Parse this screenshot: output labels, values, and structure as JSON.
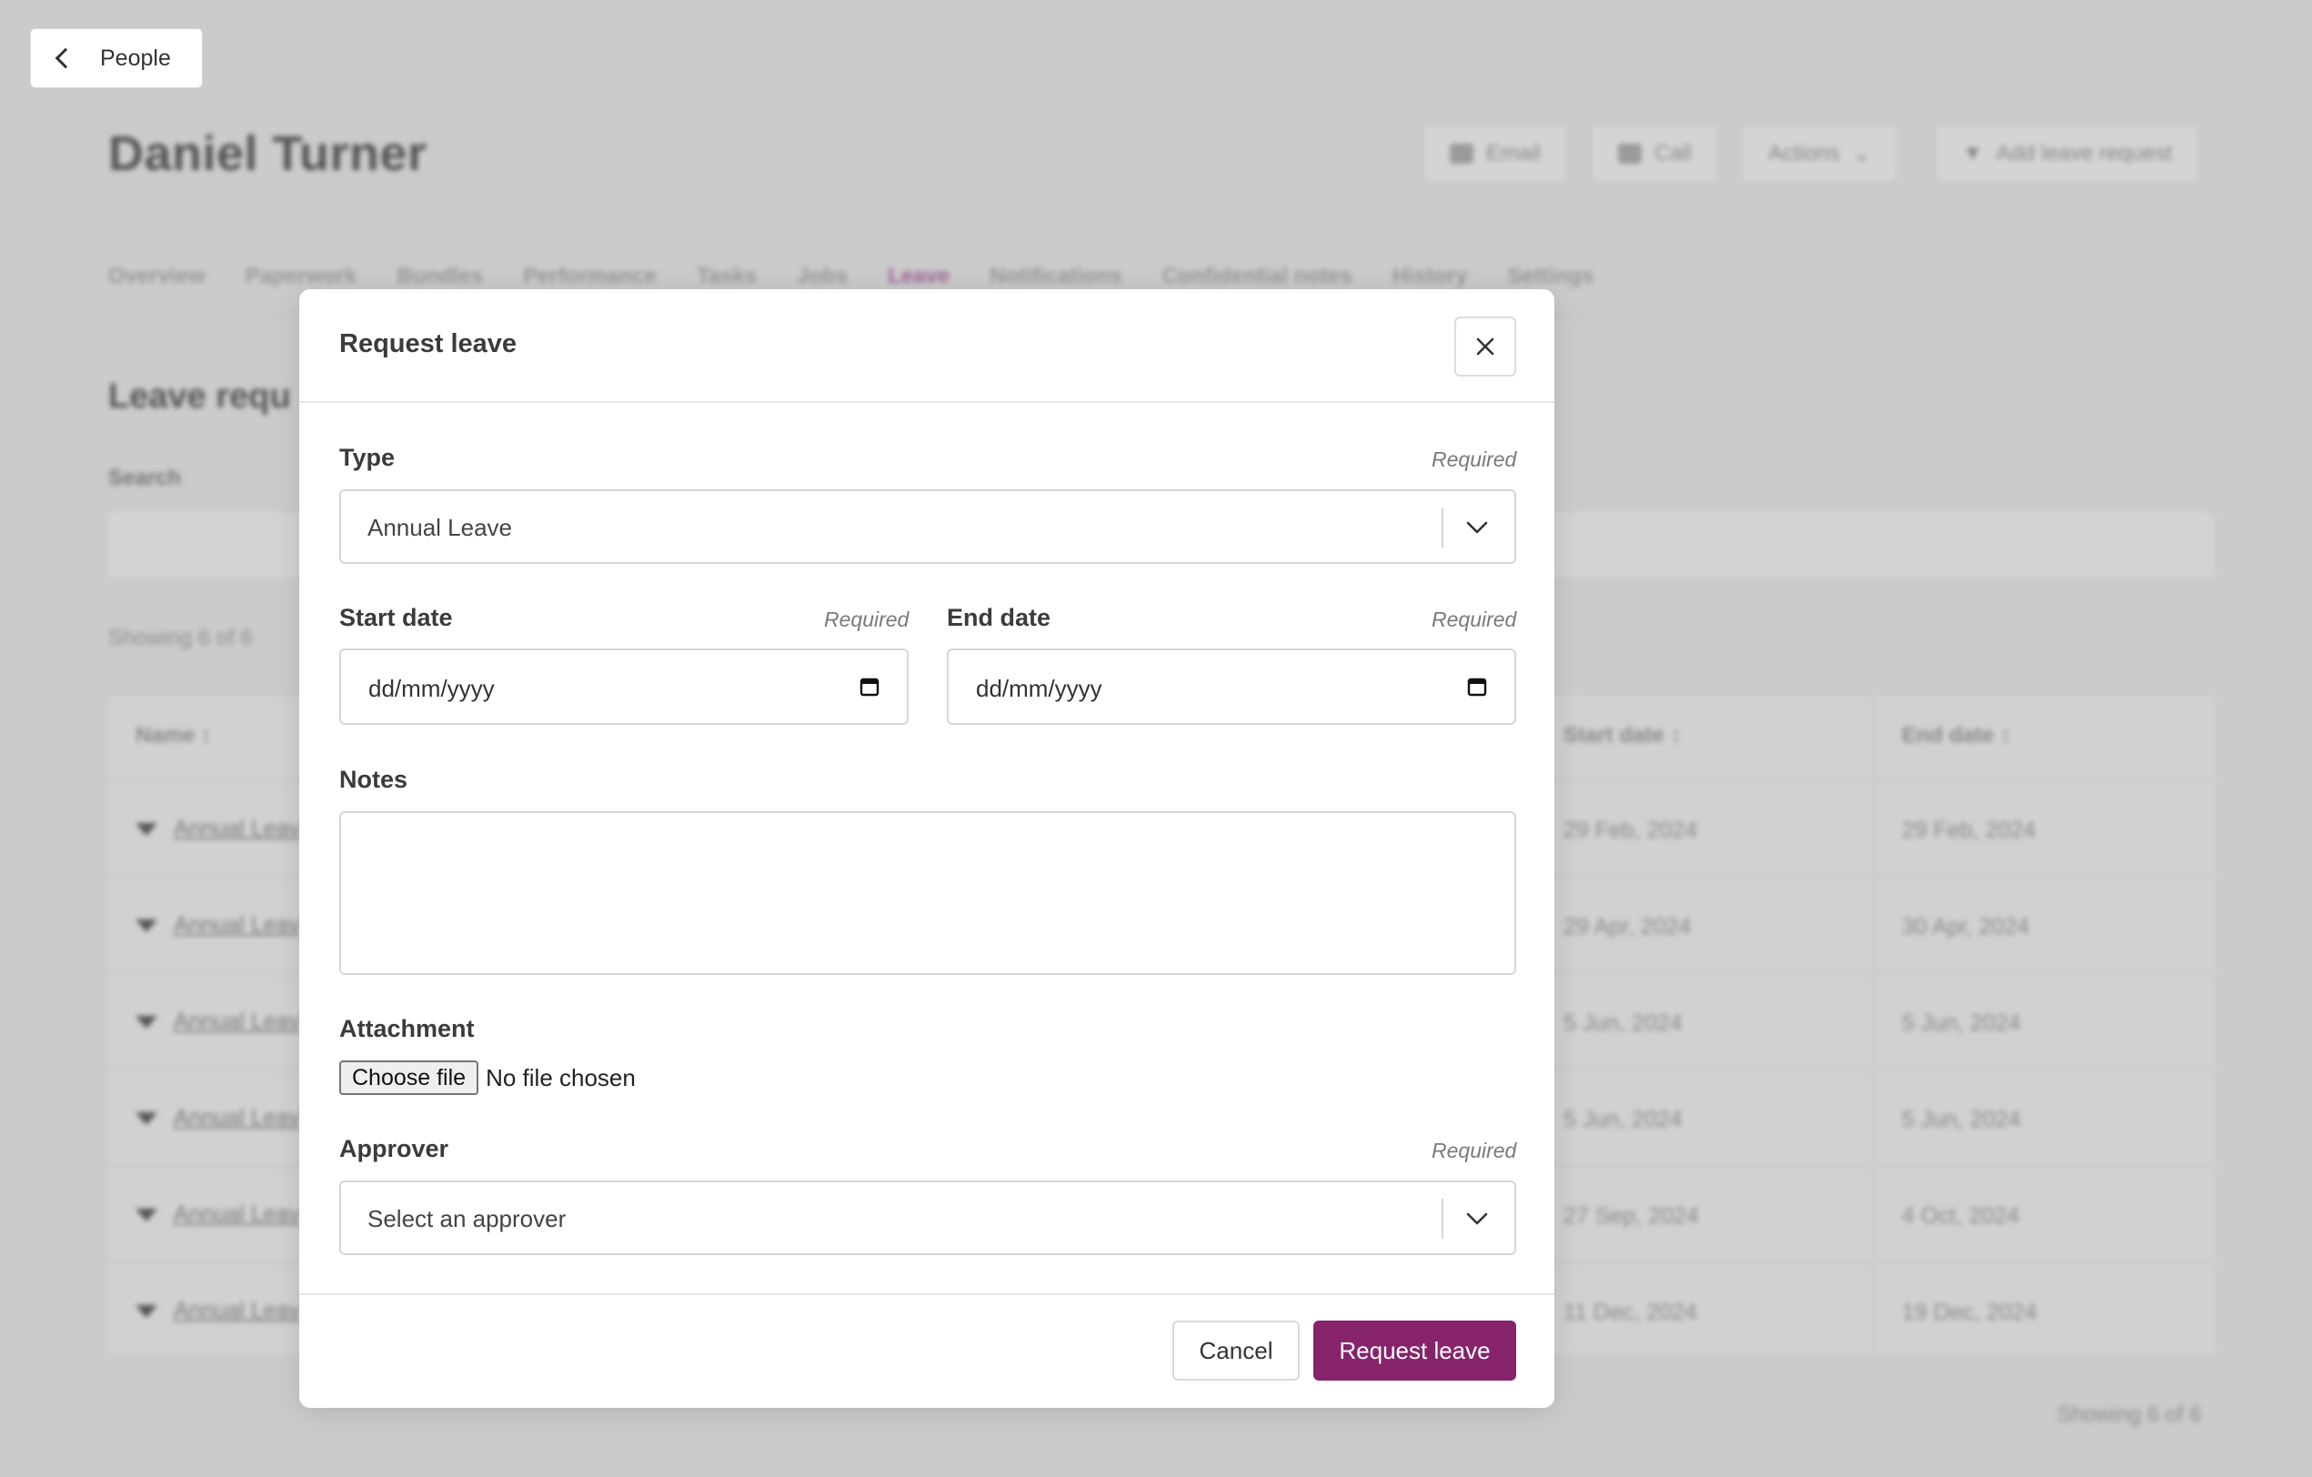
{
  "back": {
    "label": "People"
  },
  "person": {
    "name": "Daniel Turner"
  },
  "header_actions": {
    "email": "Email",
    "call": "Call",
    "actions": "Actions",
    "add_leave": "Add leave request"
  },
  "tabs": [
    "Overview",
    "Paperwork",
    "Bundles",
    "Performance",
    "Tasks",
    "Jobs",
    "Leave",
    "Notifications",
    "Confidential notes",
    "History",
    "Settings"
  ],
  "section": {
    "title": "Leave requ",
    "search_label": "Search",
    "showing_top": "Showing 6 of 6",
    "showing_bottom": "Showing 6 of 6"
  },
  "table": {
    "headers": {
      "name": "Name",
      "start": "Start date",
      "end": "End date"
    },
    "rows": [
      {
        "name": "Annual Leav",
        "start": "29 Feb, 2024",
        "end": "29 Feb, 2024"
      },
      {
        "name": "Annual Leav",
        "start": "29 Apr, 2024",
        "end": "30 Apr, 2024"
      },
      {
        "name": "Annual Leav",
        "start": "5 Jun, 2024",
        "end": "5 Jun, 2024"
      },
      {
        "name": "Annual Leav",
        "start": "5 Jun, 2024",
        "end": "5 Jun, 2024"
      },
      {
        "name": "Annual Leav",
        "start": "27 Sep, 2024",
        "end": "4 Oct, 2024"
      },
      {
        "name": "Annual Leav",
        "start": "11 Dec, 2024",
        "end": "19 Dec, 2024"
      }
    ]
  },
  "modal": {
    "title": "Request leave",
    "required_text": "Required",
    "type": {
      "label": "Type",
      "value": "Annual Leave"
    },
    "start_date": {
      "label": "Start date",
      "placeholder": "dd/mm/yyyy"
    },
    "end_date": {
      "label": "End date",
      "placeholder": "dd/mm/yyyy"
    },
    "notes": {
      "label": "Notes"
    },
    "attachment": {
      "label": "Attachment",
      "button": "Choose file",
      "status": "No file chosen"
    },
    "approver": {
      "label": "Approver",
      "placeholder": "Select an approver"
    },
    "cancel": "Cancel",
    "submit": "Request leave"
  },
  "colors": {
    "primary": "#86236b",
    "overlay": "#cbcbcb",
    "active_tab": "#a0669c"
  }
}
